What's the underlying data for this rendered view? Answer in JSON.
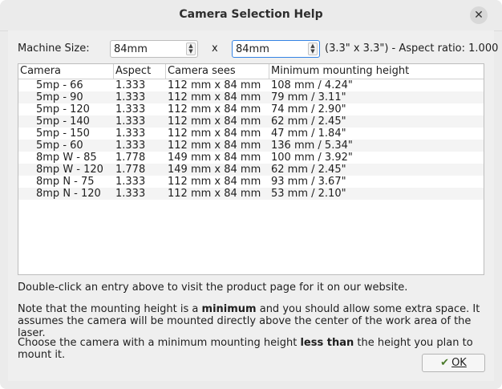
{
  "window": {
    "title": "Camera Selection Help",
    "close_glyph": "✕"
  },
  "machine": {
    "label": "Machine Size:",
    "width_value": "84mm",
    "times": "x",
    "height_value": "84mm",
    "summary": "(3.3\" x 3.3\") - Aspect ratio: 1.000"
  },
  "table": {
    "headers": [
      "Camera",
      "Aspect",
      "Camera sees",
      "Minimum mounting height"
    ],
    "rows": [
      [
        "5mp - 66",
        "1.333",
        "112 mm x 84 mm",
        "108 mm / 4.24\""
      ],
      [
        "5mp - 90",
        "1.333",
        "112 mm x 84 mm",
        "79 mm / 3.11\""
      ],
      [
        "5mp - 120",
        "1.333",
        "112 mm x 84 mm",
        "74 mm / 2.90\""
      ],
      [
        "5mp - 140",
        "1.333",
        "112 mm x 84 mm",
        "62 mm / 2.45\""
      ],
      [
        "5mp - 150",
        "1.333",
        "112 mm x 84 mm",
        "47 mm / 1.84\""
      ],
      [
        "5mp - 60",
        "1.333",
        "112 mm x 84 mm",
        "136 mm / 5.34\""
      ],
      [
        "8mp W - 85",
        "1.778",
        "149 mm x 84 mm",
        "100 mm / 3.92\""
      ],
      [
        "8mp W - 120",
        "1.778",
        "149 mm x 84 mm",
        "62 mm / 2.45\""
      ],
      [
        "8mp N - 75",
        "1.333",
        "112 mm x 84 mm",
        "93 mm / 3.67\""
      ],
      [
        "8mp N - 120",
        "1.333",
        "112 mm x 84 mm",
        "53 mm / 2.10\""
      ]
    ]
  },
  "help": {
    "line1": "Double-click an entry above to visit the product page for it on our website.",
    "note_pre": "Note that the mounting height is a ",
    "note_bold": "minimum",
    "note_post": " and you should allow some extra space. It",
    "note_line2": "assumes the camera will be mounted directly above the center of the work area of the laser.",
    "choose_pre": "Choose the camera with a minimum mounting height ",
    "choose_bold": "less than",
    "choose_post": " the height you plan to mount it."
  },
  "ok_button": {
    "icon": "checkmark-icon",
    "label": "OK"
  }
}
